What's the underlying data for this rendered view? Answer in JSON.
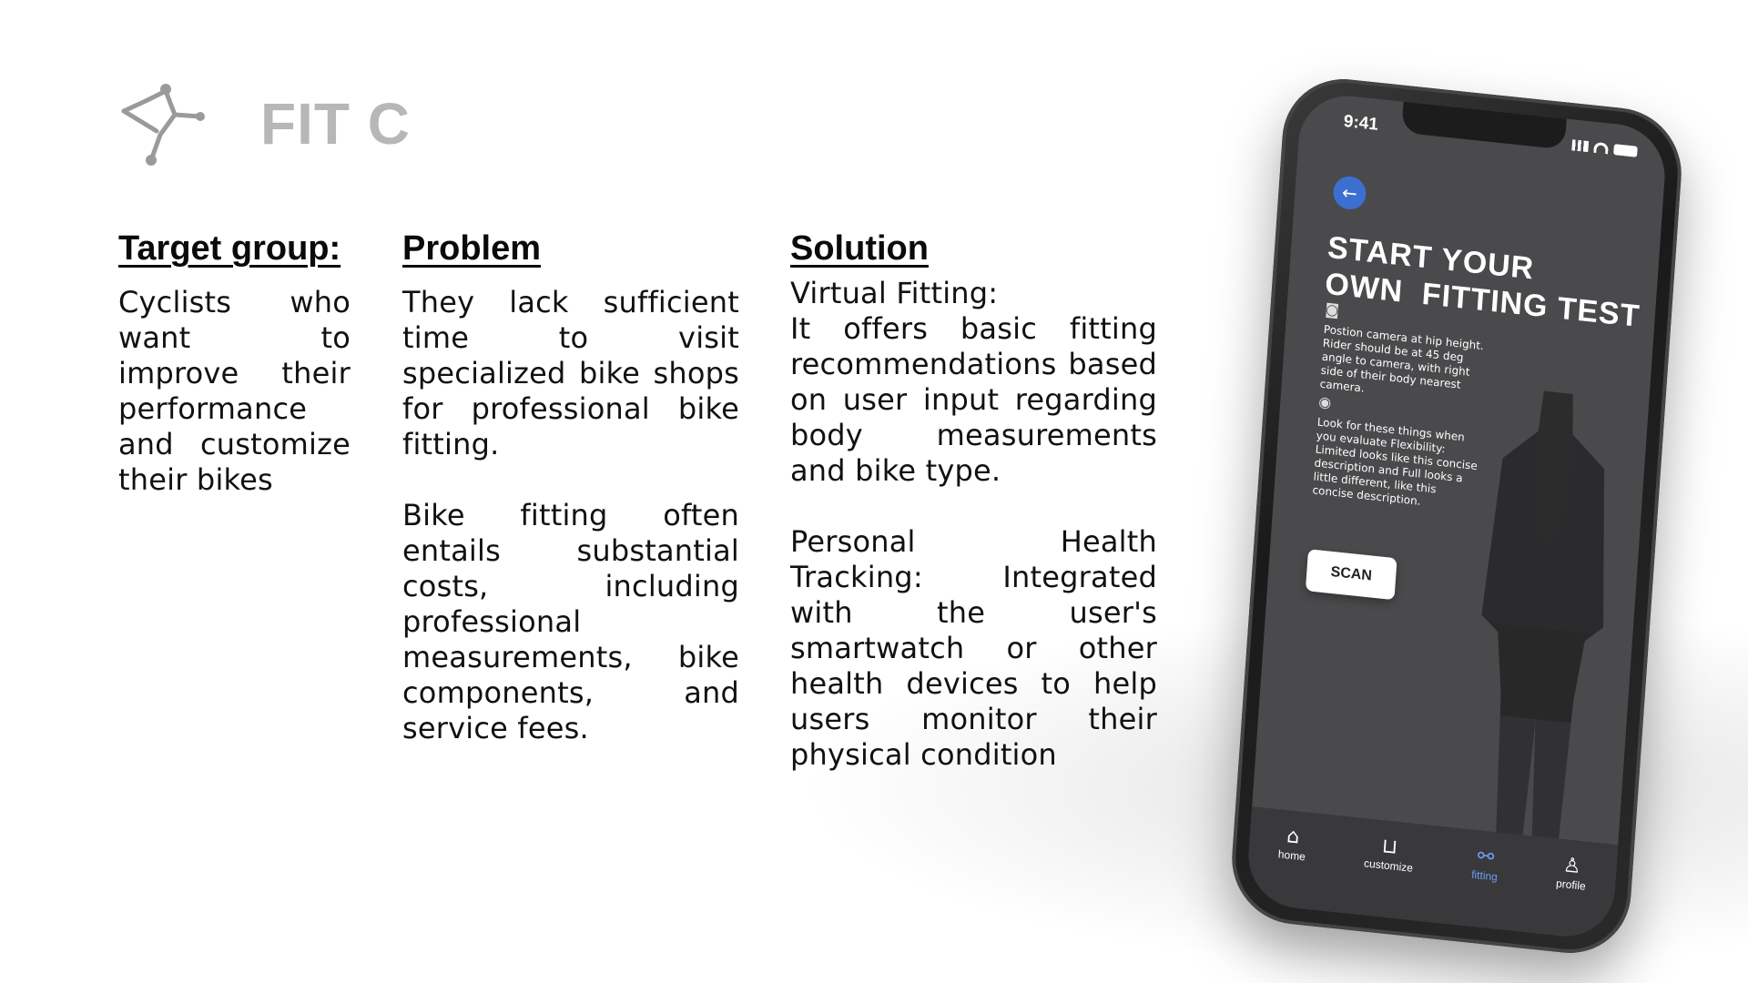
{
  "logo": {
    "text": "FIT C"
  },
  "columns": {
    "target": {
      "heading": "Target group:",
      "paragraphs": [
        "Cyclists who want to improve their performance and customize their bikes"
      ]
    },
    "problem": {
      "heading": "Problem",
      "paragraphs": [
        "They lack sufficient time to visit specialized bike shops for professional bike fitting.",
        "Bike fitting often entails substantial costs, including professional measurements, bike components, and service fees."
      ]
    },
    "solution": {
      "heading": "Solution",
      "paragraphs": [
        "Virtual Fitting:",
        "It offers basic fitting recommendations based on user input regarding body measurements and bike type.",
        "Personal Health Tracking: Integrated with the user's smartwatch or other health devices to help users monitor their physical condition"
      ]
    }
  },
  "phone": {
    "time": "9:41",
    "back_icon": "arrow-left-icon",
    "title_line1": "START YOUR",
    "title_line2": "OWN  FITTING TEST",
    "instruction1": "Postion camera at hip height. Rider should be at 45 deg angle to camera, with right side of their body nearest camera.",
    "instruction2": "Look for these things when you evaluate Flexibility: Limited looks like this concise description and Full looks a little different, like this concise description.",
    "scan_label": "SCAN",
    "tabs": [
      {
        "label": "home",
        "icon": "home-icon"
      },
      {
        "label": "customize",
        "icon": "cart-icon"
      },
      {
        "label": "fitting",
        "icon": "bike-icon"
      },
      {
        "label": "profile",
        "icon": "user-icon"
      }
    ],
    "active_tab": "fitting",
    "accent_color": "#3d6fd1"
  }
}
